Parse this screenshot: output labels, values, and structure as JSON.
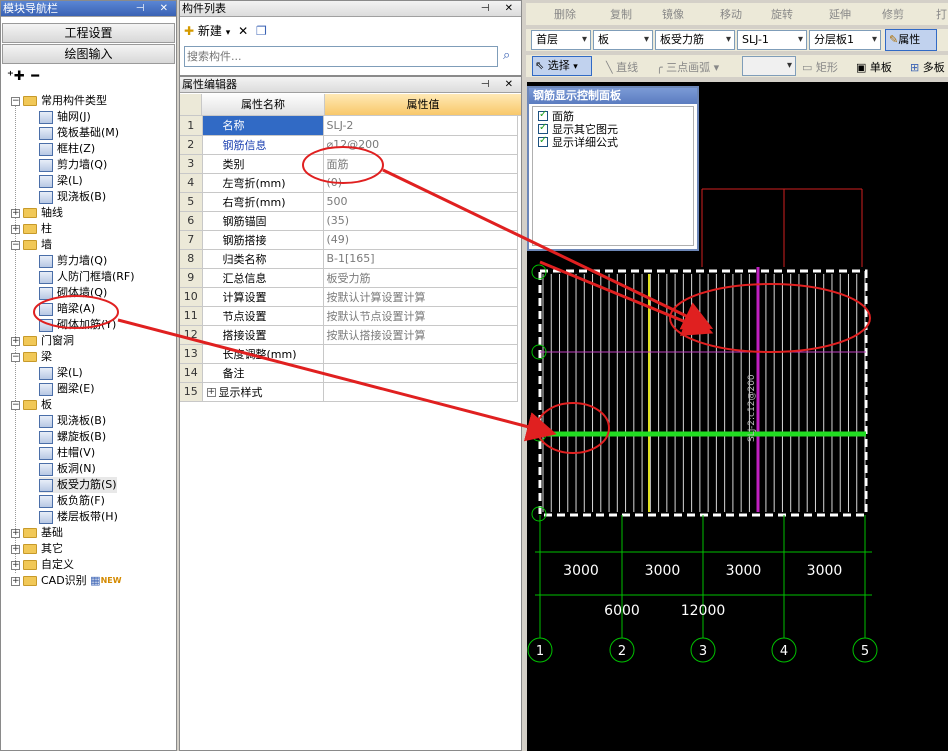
{
  "nav_panel": {
    "title": "模块导航栏",
    "buttons": [
      "工程设置",
      "绘图输入"
    ],
    "tree": [
      {
        "label": "常用构件类型",
        "type": "folder",
        "level": 0,
        "expanded": true
      },
      {
        "label": "轴网(J)",
        "type": "leaf",
        "level": 1
      },
      {
        "label": "筏板基础(M)",
        "type": "leaf",
        "level": 1
      },
      {
        "label": "框柱(Z)",
        "type": "leaf",
        "level": 1
      },
      {
        "label": "剪力墙(Q)",
        "type": "leaf",
        "level": 1
      },
      {
        "label": "梁(L)",
        "type": "leaf",
        "level": 1
      },
      {
        "label": "现浇板(B)",
        "type": "leaf",
        "level": 1
      },
      {
        "label": "轴线",
        "type": "folder",
        "level": 0,
        "expanded": false
      },
      {
        "label": "柱",
        "type": "folder",
        "level": 0,
        "expanded": false
      },
      {
        "label": "墙",
        "type": "folder",
        "level": 0,
        "expanded": true
      },
      {
        "label": "剪力墙(Q)",
        "type": "leaf",
        "level": 1
      },
      {
        "label": "人防门框墙(RF)",
        "type": "leaf",
        "level": 1
      },
      {
        "label": "砌体墙(Q)",
        "type": "leaf",
        "level": 1
      },
      {
        "label": "暗梁(A)",
        "type": "leaf",
        "level": 1
      },
      {
        "label": "砌体加筋(Y)",
        "type": "leaf",
        "level": 1
      },
      {
        "label": "门窗洞",
        "type": "folder",
        "level": 0,
        "expanded": false
      },
      {
        "label": "梁",
        "type": "folder",
        "level": 0,
        "expanded": true
      },
      {
        "label": "梁(L)",
        "type": "leaf",
        "level": 1
      },
      {
        "label": "圈梁(E)",
        "type": "leaf",
        "level": 1
      },
      {
        "label": "板",
        "type": "folder",
        "level": 0,
        "expanded": true
      },
      {
        "label": "现浇板(B)",
        "type": "leaf",
        "level": 1
      },
      {
        "label": "螺旋板(B)",
        "type": "leaf",
        "level": 1
      },
      {
        "label": "柱帽(V)",
        "type": "leaf",
        "level": 1
      },
      {
        "label": "板洞(N)",
        "type": "leaf",
        "level": 1
      },
      {
        "label": "板受力筋(S)",
        "type": "leaf",
        "level": 1,
        "selected": true
      },
      {
        "label": "板负筋(F)",
        "type": "leaf",
        "level": 1
      },
      {
        "label": "楼层板带(H)",
        "type": "leaf",
        "level": 1
      },
      {
        "label": "基础",
        "type": "folder",
        "level": 0,
        "expanded": false
      },
      {
        "label": "其它",
        "type": "folder",
        "level": 0,
        "expanded": false
      },
      {
        "label": "自定义",
        "type": "folder",
        "level": 0,
        "expanded": false
      },
      {
        "label": "CAD识别",
        "type": "folder",
        "level": 0,
        "expanded": false,
        "badge": "NEW"
      }
    ]
  },
  "component_list": {
    "title": "构件列表",
    "new_label": "新建",
    "search_placeholder": "搜索构件..."
  },
  "property_editor": {
    "title": "属性编辑器",
    "col_name": "属性名称",
    "col_value": "属性值",
    "rows": [
      {
        "n": "1",
        "name": "名称",
        "value": "SLJ-2"
      },
      {
        "n": "2",
        "name": "钢筋信息",
        "value": "⌀12@200"
      },
      {
        "n": "3",
        "name": "类别",
        "value": "面筋"
      },
      {
        "n": "4",
        "name": "左弯折(mm)",
        "value": "(0)"
      },
      {
        "n": "5",
        "name": "右弯折(mm)",
        "value": "500"
      },
      {
        "n": "6",
        "name": "钢筋锚固",
        "value": "(35)"
      },
      {
        "n": "7",
        "name": "钢筋搭接",
        "value": "(49)"
      },
      {
        "n": "8",
        "name": "归类名称",
        "value": "B-1[165]"
      },
      {
        "n": "9",
        "name": "汇总信息",
        "value": "板受力筋"
      },
      {
        "n": "10",
        "name": "计算设置",
        "value": "按默认计算设置计算"
      },
      {
        "n": "11",
        "name": "节点设置",
        "value": "按默认节点设置计算"
      },
      {
        "n": "12",
        "name": "搭接设置",
        "value": "按默认搭接设置计算"
      },
      {
        "n": "13",
        "name": "长度调整(mm)",
        "value": ""
      },
      {
        "n": "14",
        "name": "备注",
        "value": ""
      },
      {
        "n": "15",
        "name": "显示样式",
        "value": "",
        "expandable": true
      }
    ]
  },
  "toolbar1": [
    "删除",
    "复制",
    "镜像",
    "移动",
    "旋转",
    "延伸",
    "修剪",
    "打"
  ],
  "toolbar2": {
    "floor": "首层",
    "type": "板",
    "subtype": "板受力筋",
    "component": "SLJ-1",
    "layer": "分层板1",
    "properties_label": "属性"
  },
  "toolbar3": {
    "select_label": "选择",
    "line_label": "直线",
    "arc_label": "三点画弧",
    "rect_label": "矩形",
    "single_label": "单板",
    "multi_label": "多板"
  },
  "rebar_panel": {
    "title": "钢筋显示控制面板",
    "options": [
      "面筋",
      "显示其它图元",
      "显示详细公式"
    ]
  },
  "drawing": {
    "dim_row1": [
      "3000",
      "3000",
      "3000",
      "3000"
    ],
    "dim_row2": [
      "6000",
      "12000"
    ],
    "axis_labels": [
      "1",
      "2",
      "3",
      "4",
      "5"
    ],
    "rebar_text": "SLJ-2:c12@200",
    "colors": {
      "bg": "#000000",
      "grid": "#00c000",
      "rebar": "#ffffff",
      "highlight": "#22dd22",
      "annot": "#e02020"
    }
  }
}
